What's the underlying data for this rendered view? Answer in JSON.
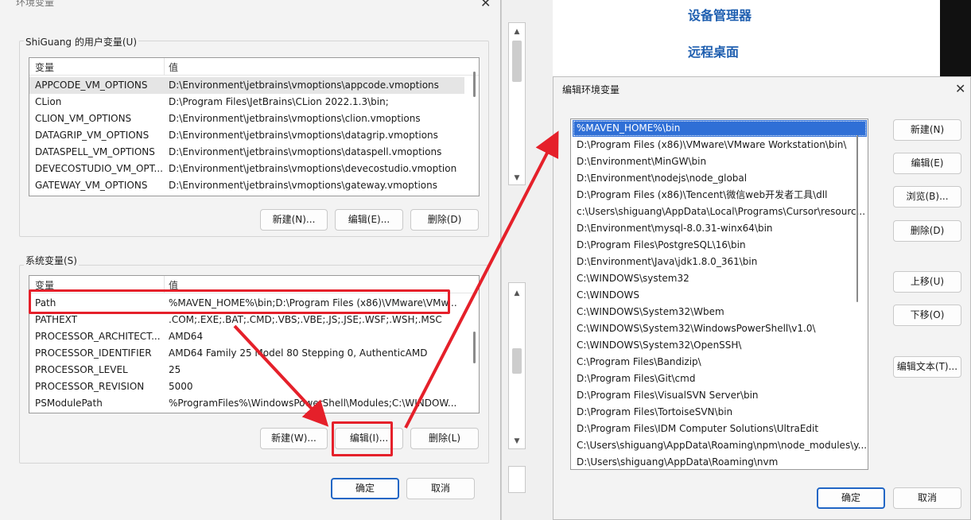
{
  "backdrop": {
    "links": [
      "设备管理器",
      "远程桌面"
    ]
  },
  "env_dialog": {
    "title": "环境变量",
    "user_group_label": "ShiGuang 的用户变量(U)",
    "system_group_label": "系统变量(S)",
    "columns": {
      "name": "变量",
      "value": "值"
    },
    "user_vars": [
      {
        "name": "APPCODE_VM_OPTIONS",
        "value": "D:\\Environment\\jetbrains\\vmoptions\\appcode.vmoptions"
      },
      {
        "name": "CLion",
        "value": "D:\\Program Files\\JetBrains\\CLion 2022.1.3\\bin;"
      },
      {
        "name": "CLION_VM_OPTIONS",
        "value": "D:\\Environment\\jetbrains\\vmoptions\\clion.vmoptions"
      },
      {
        "name": "DATAGRIP_VM_OPTIONS",
        "value": "D:\\Environment\\jetbrains\\vmoptions\\datagrip.vmoptions"
      },
      {
        "name": "DATASPELL_VM_OPTIONS",
        "value": "D:\\Environment\\jetbrains\\vmoptions\\dataspell.vmoptions"
      },
      {
        "name": "DEVECOSTUDIO_VM_OPT...",
        "value": "D:\\Environment\\jetbrains\\vmoptions\\devecostudio.vmoptions"
      },
      {
        "name": "GATEWAY_VM_OPTIONS",
        "value": "D:\\Environment\\jetbrains\\vmoptions\\gateway.vmoptions"
      }
    ],
    "system_vars": [
      {
        "name": "Path",
        "value": "%MAVEN_HOME%\\bin;D:\\Program Files (x86)\\VMware\\VMw..."
      },
      {
        "name": "PATHEXT",
        "value": ".COM;.EXE;.BAT;.CMD;.VBS;.VBE;.JS;.JSE;.WSF;.WSH;.MSC"
      },
      {
        "name": "PROCESSOR_ARCHITECT...",
        "value": "AMD64"
      },
      {
        "name": "PROCESSOR_IDENTIFIER",
        "value": "AMD64 Family 25 Model 80 Stepping 0, AuthenticAMD"
      },
      {
        "name": "PROCESSOR_LEVEL",
        "value": "25"
      },
      {
        "name": "PROCESSOR_REVISION",
        "value": "5000"
      },
      {
        "name": "PSModulePath",
        "value": "%ProgramFiles%\\WindowsPowerShell\\Modules;C:\\WINDOW..."
      }
    ],
    "user_buttons": {
      "new": "新建(N)...",
      "edit": "编辑(E)...",
      "delete": "删除(D)"
    },
    "system_buttons": {
      "new": "新建(W)...",
      "edit": "编辑(I)...",
      "delete": "删除(L)"
    },
    "ok": "确定",
    "cancel": "取消"
  },
  "edit_dialog": {
    "title": "编辑环境变量",
    "paths": [
      "%MAVEN_HOME%\\bin",
      "D:\\Program Files (x86)\\VMware\\VMware Workstation\\bin\\",
      "D:\\Environment\\MinGW\\bin",
      "D:\\Environment\\nodejs\\node_global",
      "D:\\Program Files (x86)\\Tencent\\微信web开发者工具\\dll",
      "c:\\Users\\shiguang\\AppData\\Local\\Programs\\Cursor\\resourc...",
      "D:\\Environment\\mysql-8.0.31-winx64\\bin",
      "D:\\Program Files\\PostgreSQL\\16\\bin",
      "D:\\Environment\\Java\\jdk1.8.0_361\\bin",
      "C:\\WINDOWS\\system32",
      "C:\\WINDOWS",
      "C:\\WINDOWS\\System32\\Wbem",
      "C:\\WINDOWS\\System32\\WindowsPowerShell\\v1.0\\",
      "C:\\WINDOWS\\System32\\OpenSSH\\",
      "C:\\Program Files\\Bandizip\\",
      "D:\\Program Files\\Git\\cmd",
      "D:\\Program Files\\VisualSVN Server\\bin",
      "D:\\Program Files\\TortoiseSVN\\bin",
      "D:\\Program Files\\IDM Computer Solutions\\UltraEdit",
      "C:\\Users\\shiguang\\AppData\\Roaming\\npm\\node_modules\\y...",
      "D:\\Users\\shiguang\\AppData\\Roaming\\nvm"
    ],
    "buttons": {
      "new": "新建(N)",
      "edit": "编辑(E)",
      "browse": "浏览(B)...",
      "delete": "删除(D)",
      "move_up": "上移(U)",
      "move_down": "下移(O)",
      "edit_text": "编辑文本(T)..."
    },
    "ok": "确定",
    "cancel": "取消"
  },
  "colors": {
    "annotation_red": "#e5202a",
    "selection_blue": "#2f6fd6",
    "link_blue": "#1f5fb0"
  }
}
